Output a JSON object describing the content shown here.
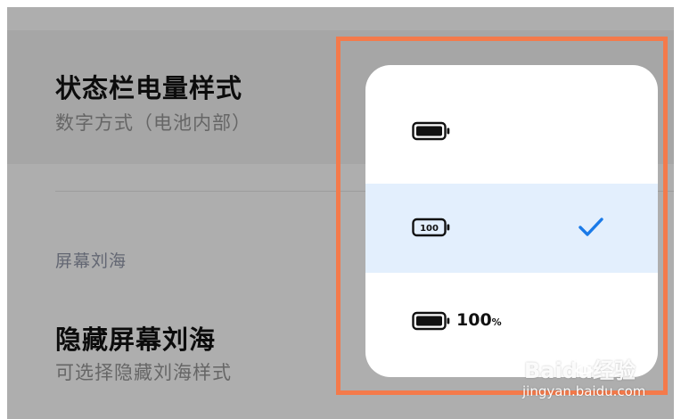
{
  "settings": {
    "battery_style": {
      "title": "状态栏电量样式",
      "subtitle": "数字方式（电池内部）"
    },
    "section_notch": "屏幕刘海",
    "hide_notch": {
      "title": "隐藏屏幕刘海",
      "subtitle": "可选择隐藏刘海样式"
    }
  },
  "popup": {
    "options": [
      {
        "icon": "battery-plain-icon",
        "selected": false
      },
      {
        "icon": "battery-number-inside-icon",
        "inside_text": "100",
        "selected": true
      },
      {
        "icon": "battery-number-outside-icon",
        "value": "100",
        "unit": "%",
        "selected": false
      }
    ]
  },
  "colors": {
    "highlight_frame": "#f47a4b",
    "selected_background": "#e3effd",
    "check_accent": "#1a7ae8"
  },
  "watermark": {
    "logo": "Baidu经验",
    "url": "jingyan.baidu.com"
  }
}
